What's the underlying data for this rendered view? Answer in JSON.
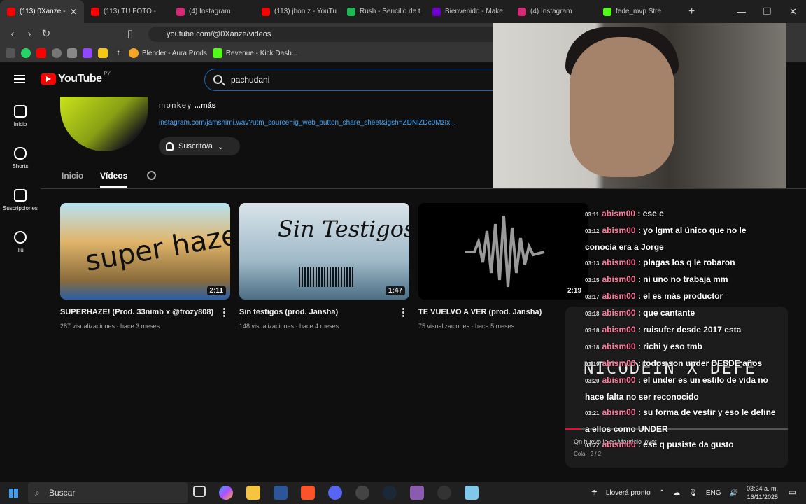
{
  "browser": {
    "tabs": [
      {
        "title": "(113) 0Xanze -",
        "color": "#ff0000",
        "active": true
      },
      {
        "title": "(113) TU FOTO -",
        "color": "#ff0000",
        "active": false
      },
      {
        "title": "(4) Instagram",
        "color": "#d62976",
        "active": false
      },
      {
        "title": "(113) jhon z - YouTu",
        "color": "#ff0000",
        "active": false
      },
      {
        "title": "Rush - Sencillo de t",
        "color": "#1db954",
        "active": false
      },
      {
        "title": "Bienvenido - Make",
        "color": "#6d00cc",
        "active": false
      },
      {
        "title": "(4) Instagram",
        "color": "#d62976",
        "active": false
      },
      {
        "title": "fede_mvp Stre",
        "color": "#53fc18",
        "active": false
      }
    ],
    "url": "youtube.com/@0Xanze/videos",
    "bookmarks": [
      {
        "label": "Blender - Aura Prods",
        "color": "#f5a623"
      },
      {
        "label": "Revenue - Kick Dash...",
        "color": "#53fc18"
      }
    ]
  },
  "youtube": {
    "logo_text": "YouTube",
    "logo_country": "PY",
    "search_value": "pachudani",
    "sidebar": [
      {
        "label": "Inicio",
        "icon": "home-icon"
      },
      {
        "label": "Shorts",
        "icon": "shorts-icon"
      },
      {
        "label": "Suscripciones",
        "icon": "subscriptions-icon"
      },
      {
        "label": "Tú",
        "icon": "you-icon"
      }
    ],
    "channel": {
      "description": "monkey",
      "more": " ...más",
      "link": "instagram.com/jamshimi.wav?utm_source=ig_web_button_share_sheet&igsh=ZDNlZDc0MzIx...",
      "subscribe_label": "Suscrito/a"
    },
    "tabs": [
      {
        "label": "Inicio",
        "selected": false
      },
      {
        "label": "Vídeos",
        "selected": true
      }
    ],
    "videos": [
      {
        "title": "SUPERHAZE! (Prod. 33nimb x @frozy808)",
        "views": "287 visualizaciones",
        "age": "hace 3 meses",
        "duration": "2:11",
        "thumb_text": "super haze"
      },
      {
        "title": "Sin testigos (prod. Jansha)",
        "views": "148 visualizaciones",
        "age": "hace 4 meses",
        "duration": "1:47",
        "thumb_text": "Sin Testigos"
      },
      {
        "title": "TE VUELVO A VER (prod. Jansha)",
        "views": "75 visualizaciones",
        "age": "hace 5 meses",
        "duration": "2:19",
        "thumb_text": ""
      }
    ]
  },
  "chat": {
    "messages": [
      {
        "time": "03:11",
        "user": "abism00",
        "text": "ese e"
      },
      {
        "time": "03:12",
        "user": "abism00",
        "text": "yo lgmt al único que no le conocía era a Jorge"
      },
      {
        "time": "03:13",
        "user": "abism00",
        "text": "plagas los q le robaron"
      },
      {
        "time": "03:15",
        "user": "abism00",
        "text": "ni uno no trabaja mm"
      },
      {
        "time": "03:17",
        "user": "abism00",
        "text": "el es más productor"
      },
      {
        "time": "03:18",
        "user": "abism00",
        "text": "que cantante"
      },
      {
        "time": "03:18",
        "user": "abism00",
        "text": "ruisufer desde 2017 esta"
      },
      {
        "time": "03:18",
        "user": "abism00",
        "text": "richi y eso tmb"
      },
      {
        "time": "03:19",
        "user": "abism00",
        "text": "todos son under DESDE años"
      },
      {
        "time": "03:20",
        "user": "abism00",
        "text": "el under es un estilo de vida no hace falta no ser reconocido"
      },
      {
        "time": "03:21",
        "user": "abism00",
        "text": "su forma de vestir y eso le define a ellos como UNDER"
      },
      {
        "time": "03:22",
        "user": "abism00",
        "text": "ese q pusiste da gusto"
      }
    ],
    "overlay_title": "NICODEIN X DEFE",
    "queue_line": "Qn huevo le es Mauricio lovet",
    "queue_sub": "Cola · 2 / 2",
    "progress": 0.07
  },
  "taskbar": {
    "search_label": "Buscar",
    "weather": "Lloverá pronto",
    "lang": "ENG",
    "time": "03:24 a. m.",
    "date": "16/11/2025"
  }
}
